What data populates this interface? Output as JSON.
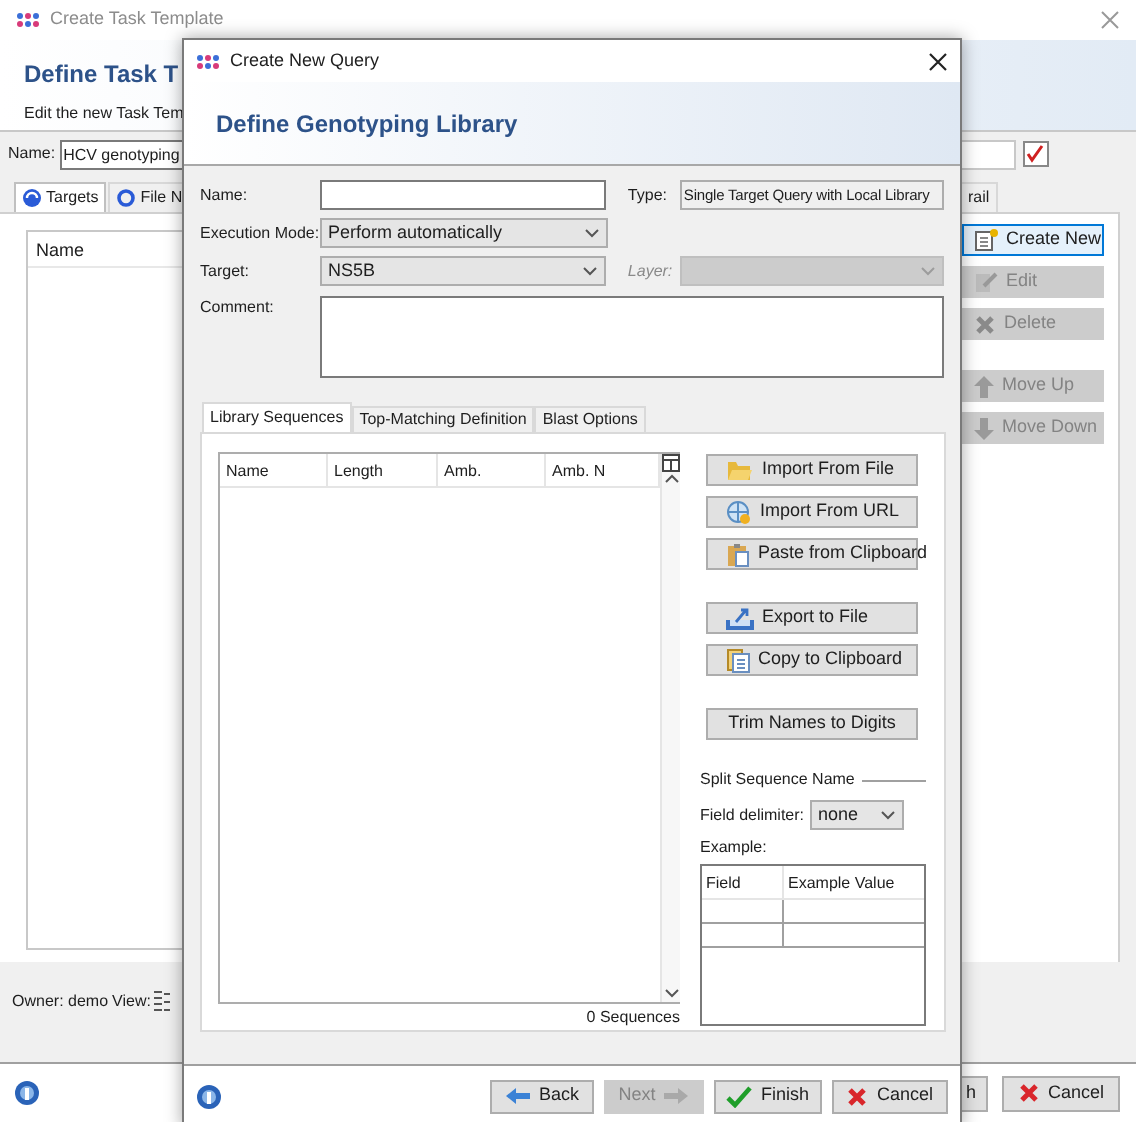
{
  "background_window": {
    "title": "Create Task Template",
    "heading": "Define Task T",
    "subtitle": "Edit the new Task Tem",
    "name_label": "Name:",
    "name_value": "HCV genotyping",
    "tabs": [
      {
        "label": "Targets",
        "selected": true
      },
      {
        "label": "File N",
        "selected": false
      },
      {
        "label": "rail",
        "selected": false
      }
    ],
    "list_columns": [
      "Name"
    ],
    "buttons": [
      {
        "label": "Create New",
        "disabled": false,
        "focused": true
      },
      {
        "label": "Edit",
        "disabled": true,
        "focused": false
      },
      {
        "label": "Delete",
        "disabled": true,
        "focused": false
      },
      {
        "label": "Move Up",
        "disabled": true,
        "focused": false
      },
      {
        "label": "Move Down",
        "disabled": true,
        "focused": false
      }
    ],
    "owner": "Owner: demo",
    "view_label": "View:",
    "footer_buttons": [
      {
        "label": "h"
      },
      {
        "label": "Cancel"
      }
    ]
  },
  "dialog": {
    "title": "Create New Query",
    "heading": "Define Genotyping Library",
    "fields": {
      "name": {
        "label": "Name:"
      },
      "type": {
        "label": "Type:",
        "value": "Single Target Query with Local Library"
      },
      "execution_mode": {
        "label": "Execution Mode:",
        "value": "Perform automatically"
      },
      "target": {
        "label": "Target:",
        "value": "NS5B"
      },
      "layer": {
        "label": "Layer:",
        "disabled": true
      },
      "comment": {
        "label": "Comment:"
      }
    },
    "tabs": [
      {
        "label": "Library Sequences",
        "selected": true
      },
      {
        "label": "Top-Matching Definition",
        "selected": false
      },
      {
        "label": "Blast Options",
        "selected": false
      }
    ],
    "table": {
      "columns": [
        "Name",
        "Length",
        "Amb.",
        "Amb. N"
      ],
      "count": "0 Sequences"
    },
    "actions": [
      {
        "label": "Import From File"
      },
      {
        "label": "Import From URL"
      },
      {
        "label": "Paste from Clipboard"
      },
      {
        "label": "Export to File"
      },
      {
        "label": "Copy to Clipboard"
      },
      {
        "label": "Trim Names to Digits"
      }
    ],
    "split": {
      "title": "Split Sequence Name",
      "delimiter_label": "Field delimiter:",
      "delimiter_value": "none",
      "example_label": "Example:",
      "columns": [
        "Field",
        "Example Value"
      ]
    },
    "footer_buttons": [
      {
        "label": "Back",
        "disabled": false
      },
      {
        "label": "Next",
        "disabled": true
      },
      {
        "label": "Finish",
        "disabled": false
      },
      {
        "label": "Cancel",
        "disabled": false
      }
    ]
  }
}
